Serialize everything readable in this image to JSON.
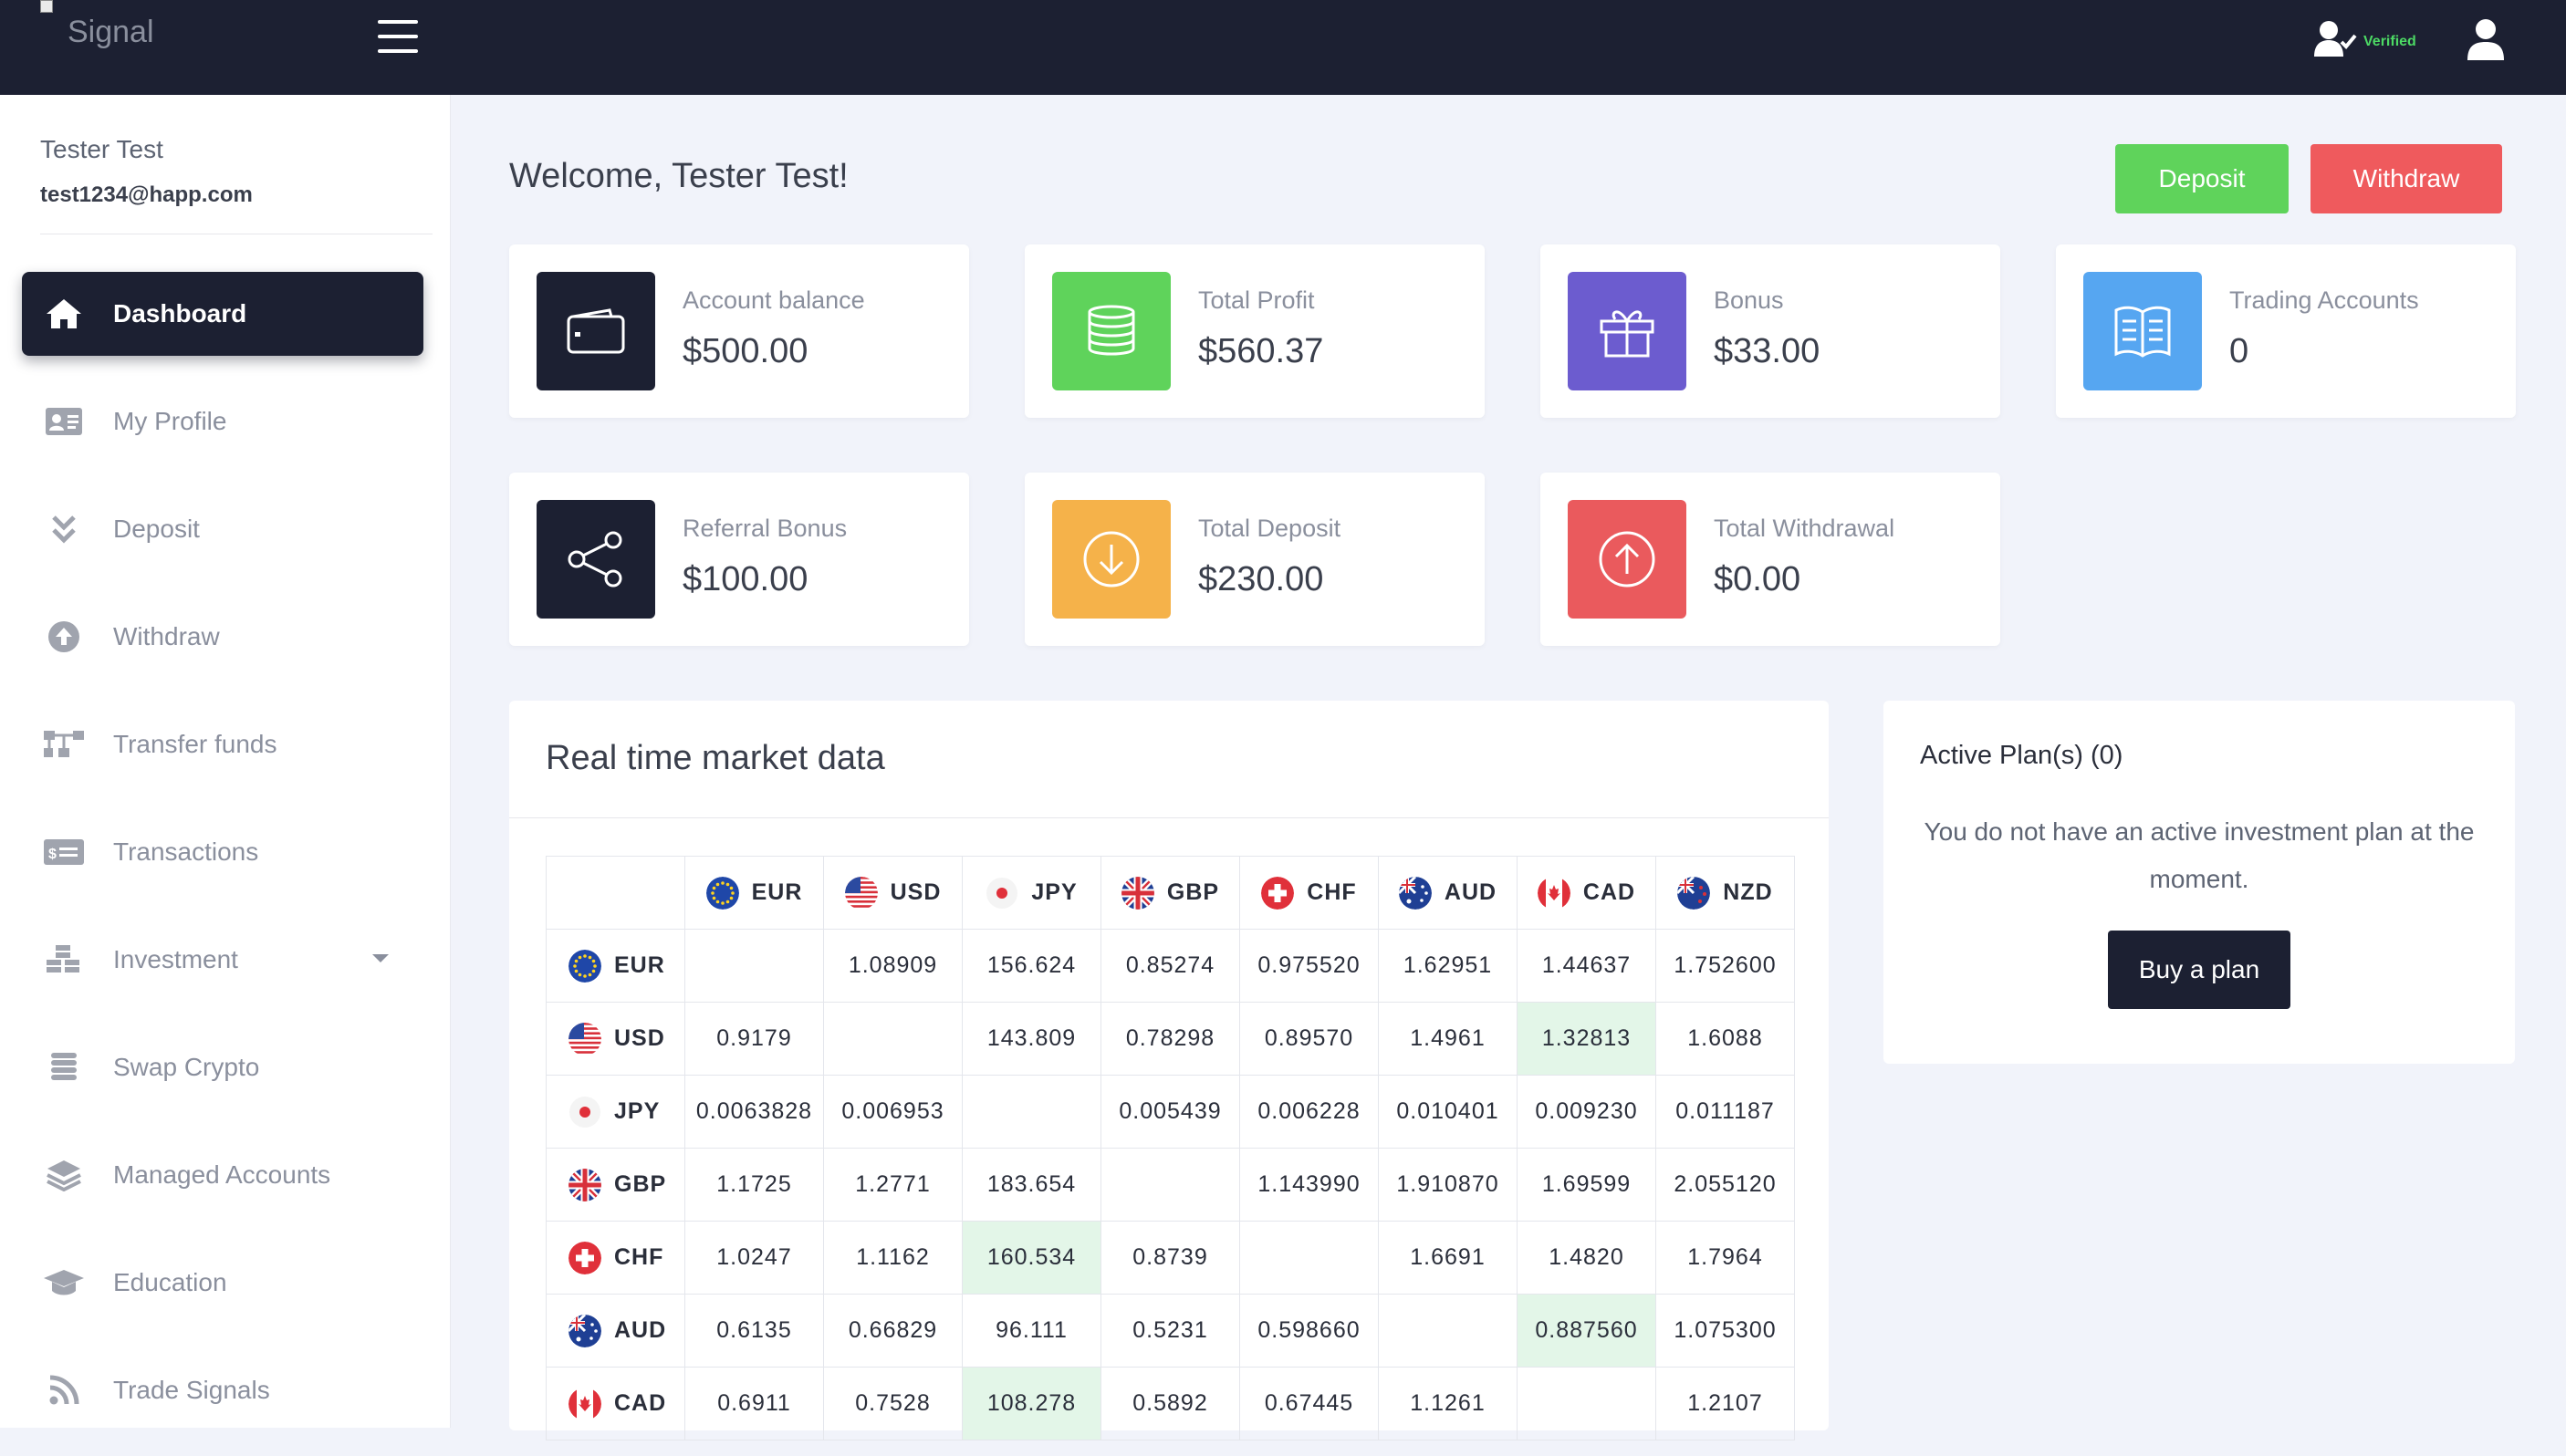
{
  "app": {
    "logo_text": "Signal",
    "verified_label": "Verified"
  },
  "user": {
    "name": "Tester Test",
    "email": "test1234@happ.com"
  },
  "sidebar": {
    "items": [
      {
        "label": "Dashboard",
        "icon": "home-icon",
        "active": true
      },
      {
        "label": "My Profile",
        "icon": "id-card-icon"
      },
      {
        "label": "Deposit",
        "icon": "chevrons-down-icon"
      },
      {
        "label": "Withdraw",
        "icon": "arrow-up-circle-icon"
      },
      {
        "label": "Transfer funds",
        "icon": "network-icon"
      },
      {
        "label": "Transactions",
        "icon": "money-bill-icon"
      },
      {
        "label": "Investment",
        "icon": "cubes-icon",
        "has_dropdown": true
      },
      {
        "label": "Swap Crypto",
        "icon": "coins-stack-icon"
      },
      {
        "label": "Managed Accounts",
        "icon": "layers-icon"
      },
      {
        "label": "Education",
        "icon": "graduation-cap-icon"
      },
      {
        "label": "Trade Signals",
        "icon": "rss-icon"
      }
    ]
  },
  "main": {
    "welcome": "Welcome, Tester Test!",
    "deposit_button": "Deposit",
    "withdraw_button": "Withdraw",
    "cards": [
      {
        "label": "Account balance",
        "value": "$500.00",
        "icon": "wallet-icon",
        "color": "#1c2032"
      },
      {
        "label": "Total Profit",
        "value": "$560.37",
        "icon": "coins-icon",
        "color": "#5fd35b"
      },
      {
        "label": "Bonus",
        "value": "$33.00",
        "icon": "gift-icon",
        "color": "#6c5ccf"
      },
      {
        "label": "Trading Accounts",
        "value": "0",
        "icon": "book-open-icon",
        "color": "#56a6f1"
      },
      {
        "label": "Referral Bonus",
        "value": "$100.00",
        "icon": "share-icon",
        "color": "#1c2032"
      },
      {
        "label": "Total Deposit",
        "value": "$230.00",
        "icon": "arrow-down-circle-icon",
        "color": "#f5b24a"
      },
      {
        "label": "Total Withdrawal",
        "value": "$0.00",
        "icon": "arrow-up-circle-icon",
        "color": "#ea5a5d"
      }
    ]
  },
  "market": {
    "title": "Real time market data",
    "currencies": [
      "EUR",
      "USD",
      "JPY",
      "GBP",
      "CHF",
      "AUD",
      "CAD",
      "NZD"
    ],
    "rows": [
      {
        "code": "EUR",
        "values": [
          "",
          "1.08909",
          "156.624",
          "0.85274",
          "0.975520",
          "1.62951",
          "1.44637",
          "1.752600"
        ],
        "highlight": []
      },
      {
        "code": "USD",
        "values": [
          "0.9179",
          "",
          "143.809",
          "0.78298",
          "0.89570",
          "1.4961",
          "1.32813",
          "1.6088"
        ],
        "highlight": [
          6
        ]
      },
      {
        "code": "JPY",
        "values": [
          "0.0063828",
          "0.006953",
          "",
          "0.005439",
          "0.006228",
          "0.010401",
          "0.009230",
          "0.011187"
        ],
        "highlight": []
      },
      {
        "code": "GBP",
        "values": [
          "1.1725",
          "1.2771",
          "183.654",
          "",
          "1.143990",
          "1.910870",
          "1.69599",
          "2.055120"
        ],
        "highlight": []
      },
      {
        "code": "CHF",
        "values": [
          "1.0247",
          "1.1162",
          "160.534",
          "0.8739",
          "",
          "1.6691",
          "1.4820",
          "1.7964"
        ],
        "highlight": [
          2
        ]
      },
      {
        "code": "AUD",
        "values": [
          "0.6135",
          "0.66829",
          "96.111",
          "0.5231",
          "0.598660",
          "",
          "0.887560",
          "1.075300"
        ],
        "highlight": [
          6
        ]
      },
      {
        "code": "CAD",
        "values": [
          "0.6911",
          "0.7528",
          "108.278",
          "0.5892",
          "0.67445",
          "1.1261",
          "",
          "1.2107"
        ],
        "highlight": [
          2
        ]
      }
    ]
  },
  "plan": {
    "title": "Active Plan(s) (0)",
    "message": "You do not have an active investment plan at the moment.",
    "button": "Buy a plan"
  }
}
